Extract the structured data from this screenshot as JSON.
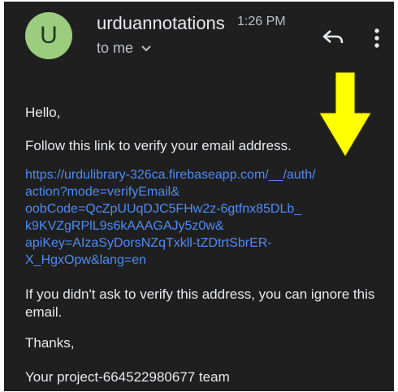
{
  "header": {
    "avatar_letter": "U",
    "sender": "urduannotations",
    "time": "1:26 PM",
    "recipient": "to me"
  },
  "message": {
    "greeting": "Hello,",
    "intro": "Follow this link to verify your email address.",
    "link_lines": [
      "https://urdulibrary-326ca.firebaseapp.com/__/auth/",
      "action?mode=verifyEmail&",
      "oobCode=QcZpUUqDJC5FHw2z-6gtfnx85DLb_",
      "k9KVZgRPlL9s6kAAAGAJy5z0w&",
      "apiKey=AIzaSyDorsNZqTxkll-tZDtrtSbrER-",
      "X_HgxOpw&lang=en"
    ],
    "ignore": "If you didn't ask to verify this address, you can ignore this email.",
    "thanks": "Thanks,",
    "signature": "Your project-664522980677 team"
  },
  "icons": {
    "reply": "reply-icon",
    "more": "more-vert-icon",
    "expand": "chevron-down-icon",
    "annotation": "yellow-down-arrow"
  },
  "colors": {
    "background": "#1f1f1f",
    "avatar": "#9ccc7e",
    "text": "#e8eaed",
    "secondary_text": "#bdc1c6",
    "link": "#4f8bf5",
    "annotation_arrow": "#ffff00"
  }
}
